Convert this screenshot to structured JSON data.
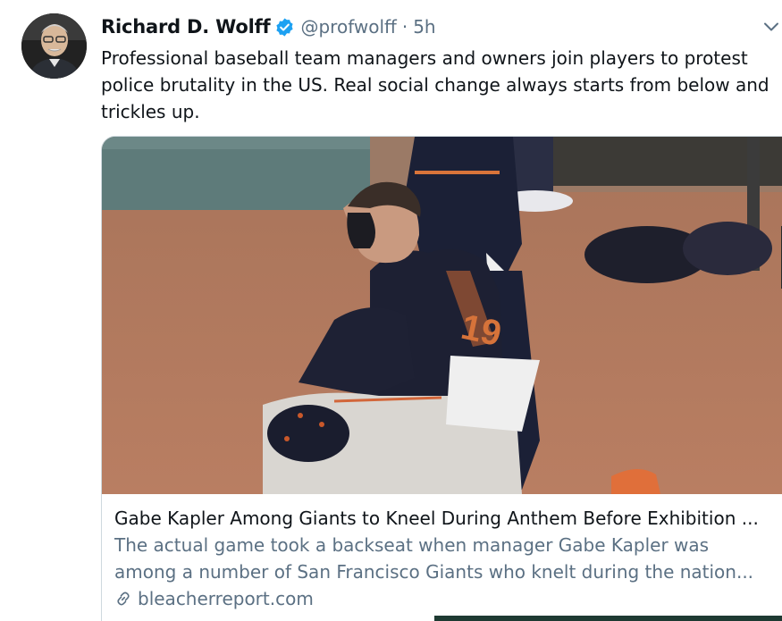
{
  "author": {
    "display_name": "Richard D. Wolff",
    "handle": "@profwolff",
    "separator": "·",
    "timestamp": "5h",
    "verified": true
  },
  "tweet": {
    "text": "Professional baseball team managers and owners join players to protest police brutality in the US. Real social change always starts from below and trickles up."
  },
  "card": {
    "title": "Gabe Kapler Among Giants to Kneel During Anthem Before Exhibition ...",
    "description": "The actual game took a backseat when manager Gabe Kapler was among a number of San Francisco Giants who knelt during the nation...",
    "domain": "bleacherreport.com"
  },
  "icons": {
    "verified": "verified-badge-icon",
    "menu": "chevron-down-icon",
    "link": "link-icon"
  },
  "colors": {
    "verified_blue": "#1da1f2",
    "secondary_text": "#5b7083",
    "primary_text": "#0f1419"
  }
}
